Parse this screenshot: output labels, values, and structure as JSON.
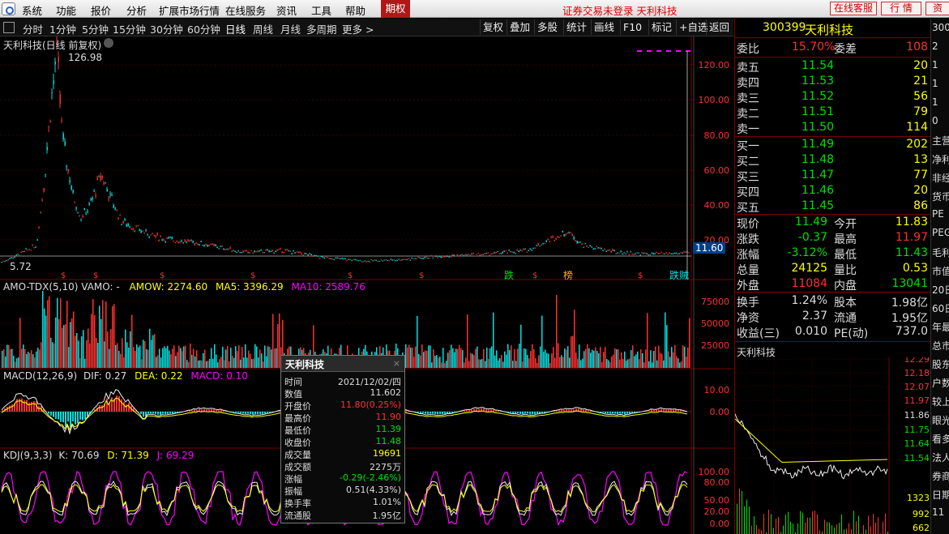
{
  "menubar": {
    "items": [
      "系统",
      "功能",
      "报价",
      "分析",
      "扩展市场行情",
      "在线服务",
      "资讯",
      "工具",
      "帮助"
    ],
    "period": "期权",
    "notice": "证券交易未登录 天利科技",
    "service_btn": "在线客服",
    "market_btn": "行 情",
    "trade_btn": "资"
  },
  "toolbar": {
    "periods": [
      "分时",
      "1分钟",
      "5分钟",
      "15分钟",
      "30分钟",
      "60分钟",
      "日线",
      "周线",
      "月线",
      "多周期",
      "更多 >"
    ],
    "active": "日线",
    "right": [
      "复权",
      "叠加",
      "多股",
      "统计",
      "画线",
      "F10",
      "标记",
      "+自选",
      "返回"
    ]
  },
  "main_chart": {
    "title": "天利科技(日线 前复权)",
    "high_label": "126.98",
    "low_label": "5.72",
    "price_tag": "11.60",
    "y_ticks": [
      "120.00",
      "100.00",
      "80.00",
      "60.00",
      "40.00",
      "20.00"
    ],
    "markers": [
      "跌",
      "榜",
      "跌",
      "贼"
    ]
  },
  "volume_panel": {
    "title": "AMO-TDX(5,10) VAMO: -",
    "amow": "AMOW: 2274.60",
    "ma5": "MA5: 3396.29",
    "ma10": "MA10: 2589.76",
    "y_ticks": [
      "75000",
      "50000",
      "25000"
    ]
  },
  "macd_panel": {
    "title": "MACD(12,26,9)",
    "dif": "DIF: 0.27",
    "dea": "DEA: 0.22",
    "macd": "MACD: 0.10",
    "y_ticks": [
      "10.00",
      "0.00"
    ]
  },
  "kdj_panel": {
    "title": "KDJ(9,3,3)",
    "k": "K: 70.69",
    "d": "D: 71.39",
    "j": "J: 69.29",
    "y_ticks": [
      "100.00",
      "80.00",
      "50.00",
      "20.00",
      "0.00"
    ]
  },
  "quote": {
    "code": "300399",
    "name": "天利科技",
    "wb": {
      "label": "委比",
      "value": "15.70%",
      "label2": "委差",
      "value2": "108"
    },
    "asks": [
      {
        "label": "卖五",
        "price": "11.54",
        "vol": "20"
      },
      {
        "label": "卖四",
        "price": "11.53",
        "vol": "21"
      },
      {
        "label": "卖三",
        "price": "11.52",
        "vol": "56"
      },
      {
        "label": "卖二",
        "price": "11.51",
        "vol": "79"
      },
      {
        "label": "卖一",
        "price": "11.50",
        "vol": "114"
      }
    ],
    "bids": [
      {
        "label": "买一",
        "price": "11.49",
        "vol": "202"
      },
      {
        "label": "买二",
        "price": "11.48",
        "vol": "13"
      },
      {
        "label": "买三",
        "price": "11.47",
        "vol": "77"
      },
      {
        "label": "买四",
        "price": "11.46",
        "vol": "20"
      },
      {
        "label": "买五",
        "price": "11.45",
        "vol": "86"
      }
    ],
    "stats": [
      {
        "l1": "现价",
        "v1": "11.49",
        "c1": "#00e000",
        "l2": "今开",
        "v2": "11.83",
        "c2": "#ffff00"
      },
      {
        "l1": "涨跌",
        "v1": "-0.37",
        "c1": "#00e000",
        "l2": "最高",
        "v2": "11.97",
        "c2": "#ff3030"
      },
      {
        "l1": "涨幅",
        "v1": "-3.12%",
        "c1": "#00e000",
        "l2": "最低",
        "v2": "11.43",
        "c2": "#00e000"
      },
      {
        "l1": "总量",
        "v1": "24125",
        "c1": "#ffff00",
        "l2": "量比",
        "v2": "0.53",
        "c2": "#ffff00"
      },
      {
        "l1": "外盘",
        "v1": "11084",
        "c1": "#ff3030",
        "l2": "内盘",
        "v2": "13041",
        "c2": "#00e000"
      }
    ],
    "stats2": [
      {
        "l1": "换手",
        "v1": "1.24%",
        "l2": "股本",
        "v2": "1.98亿"
      },
      {
        "l1": "净资",
        "v1": "2.37",
        "l2": "流通",
        "v2": "1.95亿"
      },
      {
        "l1": "收益(三)",
        "v1": "0.010",
        "l2": "PE(动)",
        "v2": "737.0"
      }
    ]
  },
  "mini_chart": {
    "title": "天利科技",
    "prices": [
      "12.29",
      "12.18",
      "12.07",
      "11.97",
      "11.86",
      "11.75",
      "11.64",
      "11.54"
    ],
    "vols": [
      "1323",
      "992",
      "662"
    ]
  },
  "popup": {
    "title": "天利科技",
    "rows": [
      {
        "k": "时间",
        "v": "2021/12/02/四",
        "c": "#ddd"
      },
      {
        "k": "数值",
        "v": "11.602",
        "c": "#ddd"
      },
      {
        "k": "开盘价",
        "v": "11.80(0.25%)",
        "c": "#ff3030"
      },
      {
        "k": "最高价",
        "v": "11.90",
        "c": "#ff3030"
      },
      {
        "k": "最低价",
        "v": "11.39",
        "c": "#00e000"
      },
      {
        "k": "收盘价",
        "v": "11.48",
        "c": "#00e000"
      },
      {
        "k": "成交量",
        "v": "19691",
        "c": "#ffff00"
      },
      {
        "k": "成交额",
        "v": "2275万",
        "c": "#ddd"
      },
      {
        "k": "涨幅",
        "v": "-0.29(-2.46%)",
        "c": "#00e000"
      },
      {
        "k": "振幅",
        "v": "0.51(4.33%)",
        "c": "#ddd"
      },
      {
        "k": "换手率",
        "v": "1.01%",
        "c": "#ddd"
      },
      {
        "k": "流通股",
        "v": "1.95亿",
        "c": "#ddd"
      }
    ]
  },
  "far_right": {
    "items": [
      "300",
      "2",
      "1",
      "1",
      "1",
      "0",
      "主营",
      "净利",
      "非经",
      "货币",
      "PE",
      "PEG",
      "毛利",
      "市值",
      "20日",
      "60日",
      "年最",
      "总市",
      "股东",
      "户数",
      "较上",
      "眼光",
      "看多",
      "法人",
      "券商",
      "日期",
      "11"
    ]
  },
  "colors": {
    "up": "#ff3030",
    "down": "#00e0e0",
    "green": "#00e000",
    "yellow": "#ffff00",
    "magenta": "#ff00ff",
    "grid": "#7a0000"
  }
}
